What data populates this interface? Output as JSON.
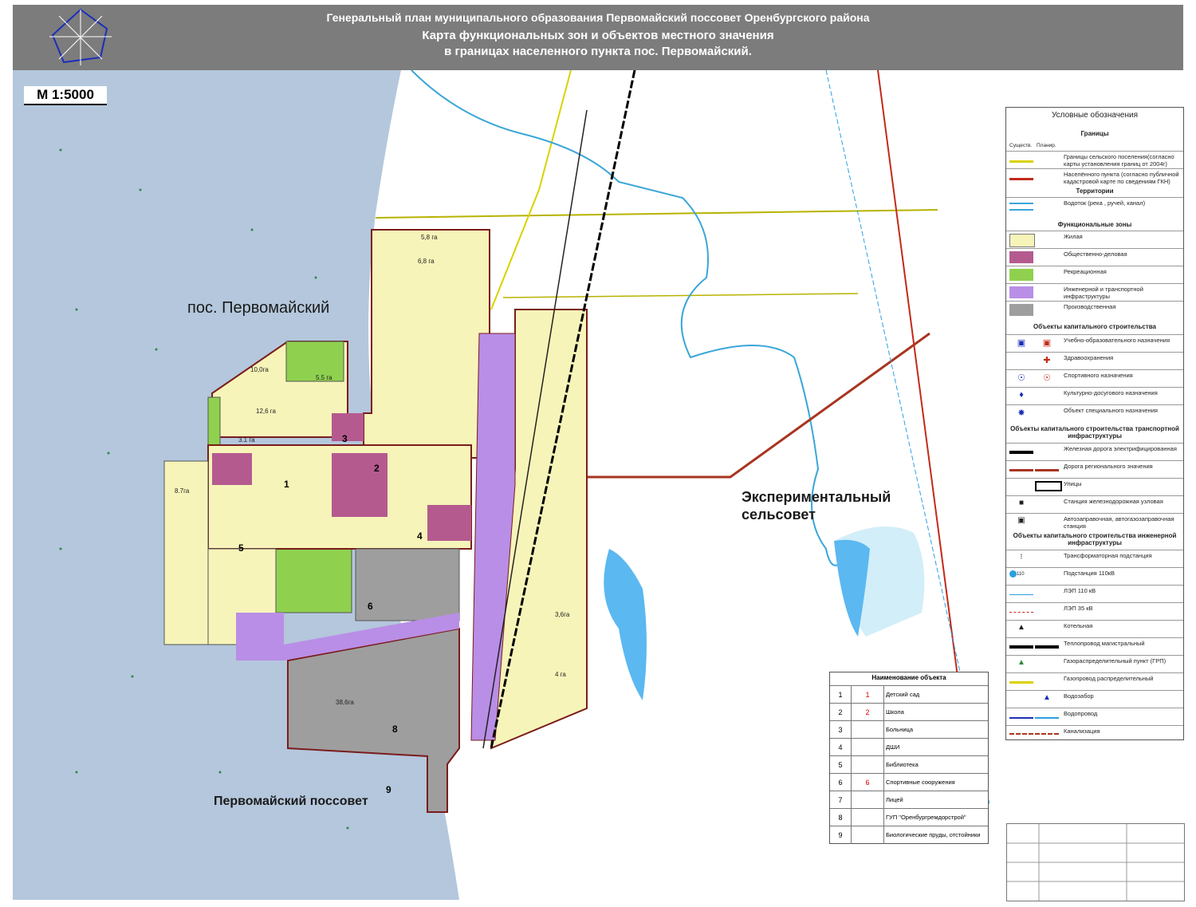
{
  "header": {
    "line1": "Генеральный план муниципального образования Первомайский поссовет Оренбургского района",
    "line2": "Карта функциональных зон и объектов местного значения",
    "line3": "в границах населенного пункта пос. Первомайский."
  },
  "scale": "М 1:5000",
  "places": {
    "settlement": "пос. Первомайский",
    "exp_line1": "Экспериментальный",
    "exp_line2": "сельсовет",
    "possovet": "Первомайский поссовет"
  },
  "areas": [
    "5,8 га",
    "6,8 га",
    "10,0га",
    "5.5 га",
    "12,6 га",
    "3.1 га",
    "8.7га",
    "38,6га",
    "3,6га",
    "4 га"
  ],
  "colors": {
    "water_bg": "#b4c7dc",
    "residential": "#f7f4b9",
    "business": "#b55a8f",
    "recreation": "#8fd14f",
    "infrastructure": "#b98ee6",
    "industrial": "#9e9e9e",
    "lake": "#5bb8f0",
    "regional_road": "#a83520",
    "border_red": "#c22a1a"
  },
  "legend": {
    "title": "Условные обозначения",
    "sec_borders": "Границы",
    "col_exist": "Существ.",
    "col_plan": "Планир.",
    "border_rural": "Границы сельского поселения(согласно карты установления границ от 2004г)",
    "border_settlement": "Населённого пункта (согласно публичной кадастровой карте по сведениям ГКН)",
    "sec_territories": "Территории",
    "watercourse": "Водоток (река , ручей, канал)",
    "sec_zones": "Функциональные зоны",
    "zone_residential": "Жилая",
    "zone_business": "Общественно-деловая",
    "zone_recreation": "Рекреационная",
    "zone_infra": "Инженерной и транспортной инфраструктуры",
    "zone_industrial": "Производственная",
    "sec_capital": "Объекты капитального строительства",
    "obj_edu": "Учебно-образовательного назначения",
    "obj_health": "Здравоохранения",
    "obj_sport": "Спортивного назначения",
    "obj_culture": "Культурно-досугового назначения",
    "obj_special": "Объект специального назначения",
    "sec_transport": "Объекты капитального строительства транспортной инфраструктуры",
    "rail": "Железная дорога электрифицированная",
    "road_regional": "Дорога регионального значения",
    "streets": "Улицы",
    "station": "Станция железнодорожная узловая",
    "fuel": "Автозаправочная, автогазозаправочная станция",
    "sec_engineering": "Объекты капитального строительства инженерной инфраструктуры",
    "transformer": "Трансформаторная подстанция",
    "substation": "Подстанция 110кВ",
    "substation_num": "110",
    "lep110": "ЛЭП 110 кВ",
    "lep35": "ЛЭП 35 кВ",
    "boiler": "Котельная",
    "heat_main": "Теплопровод магистральный",
    "grp": "Газораспределительный пункт (ГРП)",
    "gas_pipe": "Газопровод распределительный",
    "water_intake": "Водозабор",
    "water_pipe": "Водопровод",
    "sewer": "Канализация"
  },
  "objects": {
    "title": "Наименование объекта",
    "rows": [
      {
        "num": "1",
        "sym": "1",
        "name": "Детский сад"
      },
      {
        "num": "2",
        "sym": "2",
        "name": "Школа"
      },
      {
        "num": "3",
        "sym": "",
        "name": "Больница"
      },
      {
        "num": "4",
        "sym": "",
        "name": "ДШИ"
      },
      {
        "num": "5",
        "sym": "",
        "name": "Библиотека"
      },
      {
        "num": "6",
        "sym": "6",
        "name": "Спортивные сооружения"
      },
      {
        "num": "7",
        "sym": "",
        "name": "Лицей"
      },
      {
        "num": "8",
        "sym": "",
        "name": "ГУП \"Оренбургремдорстрой\""
      },
      {
        "num": "9",
        "sym": "",
        "name": "Биологические пруды, отстойники"
      }
    ]
  },
  "map_markers": [
    "1",
    "2",
    "3",
    "4",
    "5",
    "6",
    "8",
    "9"
  ]
}
